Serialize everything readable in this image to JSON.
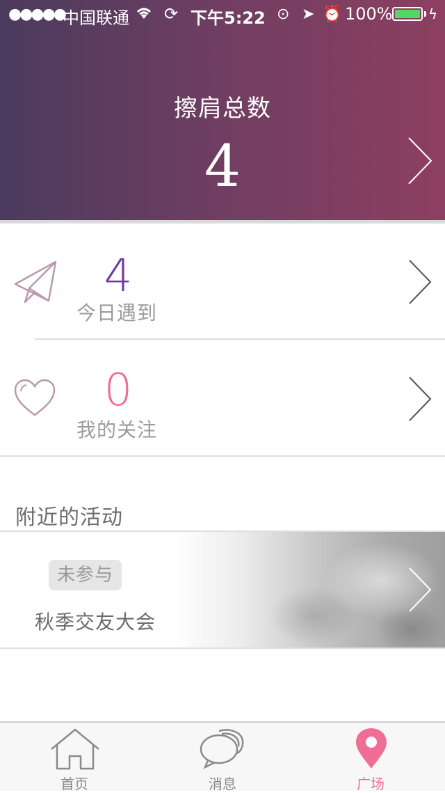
{
  "status_bar": {
    "signal": "●●●●●",
    "carrier": "中国联通",
    "time": "下午5:22",
    "battery": "100%"
  },
  "header": {
    "title": "擦肩总数",
    "count": "4"
  },
  "stats": [
    {
      "value": "4",
      "label": "今日遇到",
      "icon": "paper-plane-icon",
      "color": "#6f3a9e"
    },
    {
      "value": "0",
      "label": "我的关注",
      "icon": "heart-icon",
      "color": "#f06d96"
    }
  ],
  "nearby": {
    "title": "附近的活动",
    "items": [
      {
        "status": "未参与",
        "name": "秋季交友大会"
      }
    ]
  },
  "tabbar": {
    "items": [
      {
        "label": "首页",
        "icon": "house-icon",
        "active": false
      },
      {
        "label": "消息",
        "icon": "chat-bubbles-icon",
        "active": false
      },
      {
        "label": "广场",
        "icon": "location-pin-icon",
        "active": true
      }
    ],
    "active_color": "#f06d96",
    "inactive_color": "#8a8a8a"
  }
}
